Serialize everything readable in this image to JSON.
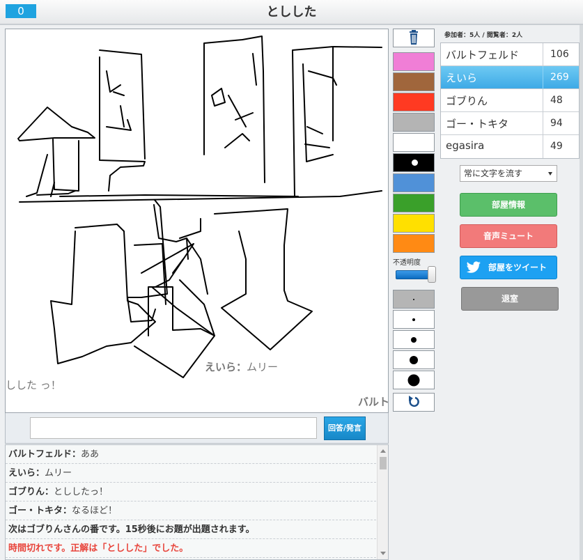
{
  "header": {
    "score": "0",
    "title": "としした"
  },
  "canvas": {
    "flowing_messages": [
      {
        "name": "えいら",
        "sep": "：",
        "text": "ムリー"
      },
      {
        "name": "",
        "sep": "",
        "text": "しした っ！"
      },
      {
        "name": "バルト",
        "sep": "",
        "text": ""
      }
    ]
  },
  "input": {
    "placeholder": "",
    "value": "",
    "answer_label": "回答/発言"
  },
  "chat": [
    {
      "name": "バルトフェルド",
      "sep": "：",
      "msg": "ああ",
      "kind": "user"
    },
    {
      "name": "えいら",
      "sep": "：",
      "msg": "ムリー",
      "kind": "user"
    },
    {
      "name": "ゴブりん",
      "sep": "：",
      "msg": "とししたっ！",
      "kind": "user"
    },
    {
      "name": "ゴー・トキタ",
      "sep": "：",
      "msg": "なるほど！",
      "kind": "user"
    },
    {
      "name": "",
      "sep": "",
      "msg": "次はゴブりんさんの番です。15秒後にお題が出題されます。",
      "kind": "system"
    },
    {
      "name": "",
      "sep": "",
      "msg": "時間切れです。正解は「としした」でした。",
      "kind": "alert"
    }
  ],
  "tools": {
    "trash_icon": "trash-icon",
    "colors": [
      "#f07ed6",
      "#a0663c",
      "#ff3a22",
      "#b4b4b4",
      "#ffffff",
      "#000000",
      "#5091d8",
      "#3aa02a",
      "#ffe000",
      "#ff8a14"
    ],
    "selected_color_index": 5,
    "opacity_label": "不透明度",
    "opacity_value": 1.0,
    "undo_icon": "undo-icon"
  },
  "room": {
    "counts": "参加者：5人 / 閲覧者：2人",
    "players": [
      {
        "name": "バルトフェルド",
        "score": "106",
        "active": false
      },
      {
        "name": "えいら",
        "score": "269",
        "active": true
      },
      {
        "name": "ゴブりん",
        "score": "48",
        "active": false
      },
      {
        "name": "ゴー・トキタ",
        "score": "94",
        "active": false
      },
      {
        "name": "egasira",
        "score": "49",
        "active": false
      }
    ],
    "flow_option": "常に文字を流す",
    "buttons": {
      "info": "部屋情報",
      "mute": "音声ミュート",
      "tweet": "部屋をツイート",
      "leave": "退室"
    }
  },
  "colors": {
    "accent": "#1fa3e0",
    "info_btn": "#5bbf6a",
    "mute_btn": "#f27a7a",
    "tweet_btn": "#1da1f2",
    "leave_btn": "#999999",
    "alert_text": "#e8453c"
  }
}
